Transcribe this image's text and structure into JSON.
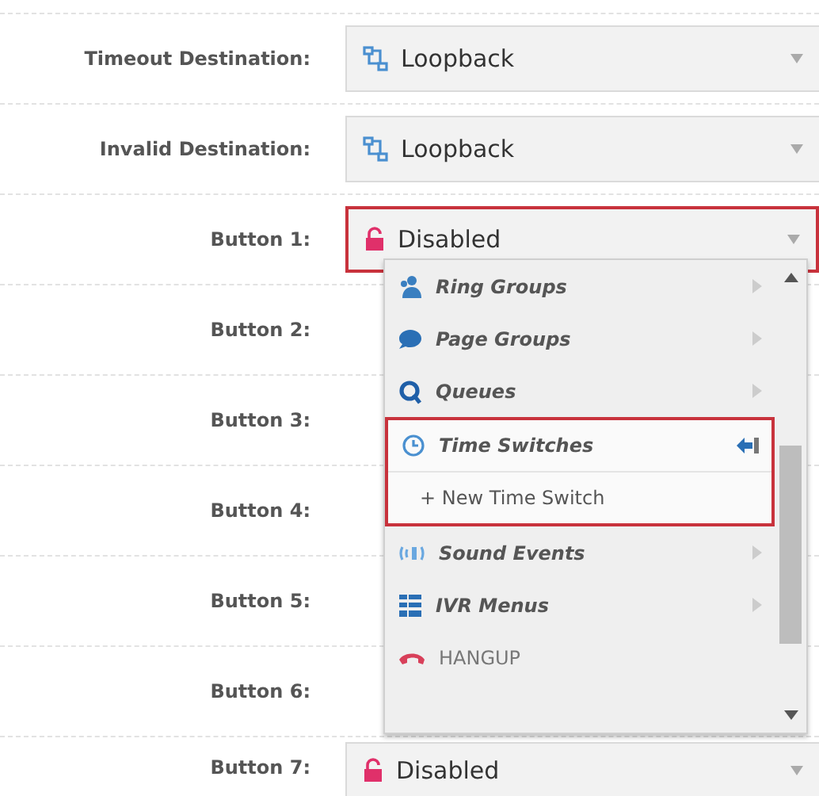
{
  "rows": [
    {
      "label": "Timeout Destination:",
      "field": {
        "kind": "loopback",
        "value": "Loopback",
        "highlighted": false
      }
    },
    {
      "label": "Invalid Destination:",
      "field": {
        "kind": "loopback",
        "value": "Loopback",
        "highlighted": false
      }
    },
    {
      "label": "Button 1:",
      "field": {
        "kind": "disabled",
        "value": "Disabled",
        "highlighted": true
      }
    },
    {
      "label": "Button 2:"
    },
    {
      "label": "Button 3:"
    },
    {
      "label": "Button 4:"
    },
    {
      "label": "Button 5:"
    },
    {
      "label": "Button 6:"
    },
    {
      "label": "Button 7:",
      "field": {
        "kind": "disabled",
        "value": "Disabled",
        "highlighted": false
      }
    }
  ],
  "menu": {
    "items": [
      {
        "kind": "category",
        "label": "Ring Groups",
        "expanded": false
      },
      {
        "kind": "category",
        "label": "Page Groups",
        "expanded": false
      },
      {
        "kind": "category",
        "label": "Queues",
        "expanded": false
      },
      {
        "kind": "category",
        "label": "Time Switches",
        "expanded": true,
        "children": [
          {
            "label": "+ New Time Switch"
          }
        ]
      },
      {
        "kind": "category",
        "label": "Sound Events",
        "expanded": false
      },
      {
        "kind": "category",
        "label": "IVR Menus",
        "expanded": false
      },
      {
        "kind": "action",
        "label": "HANGUP"
      }
    ]
  }
}
